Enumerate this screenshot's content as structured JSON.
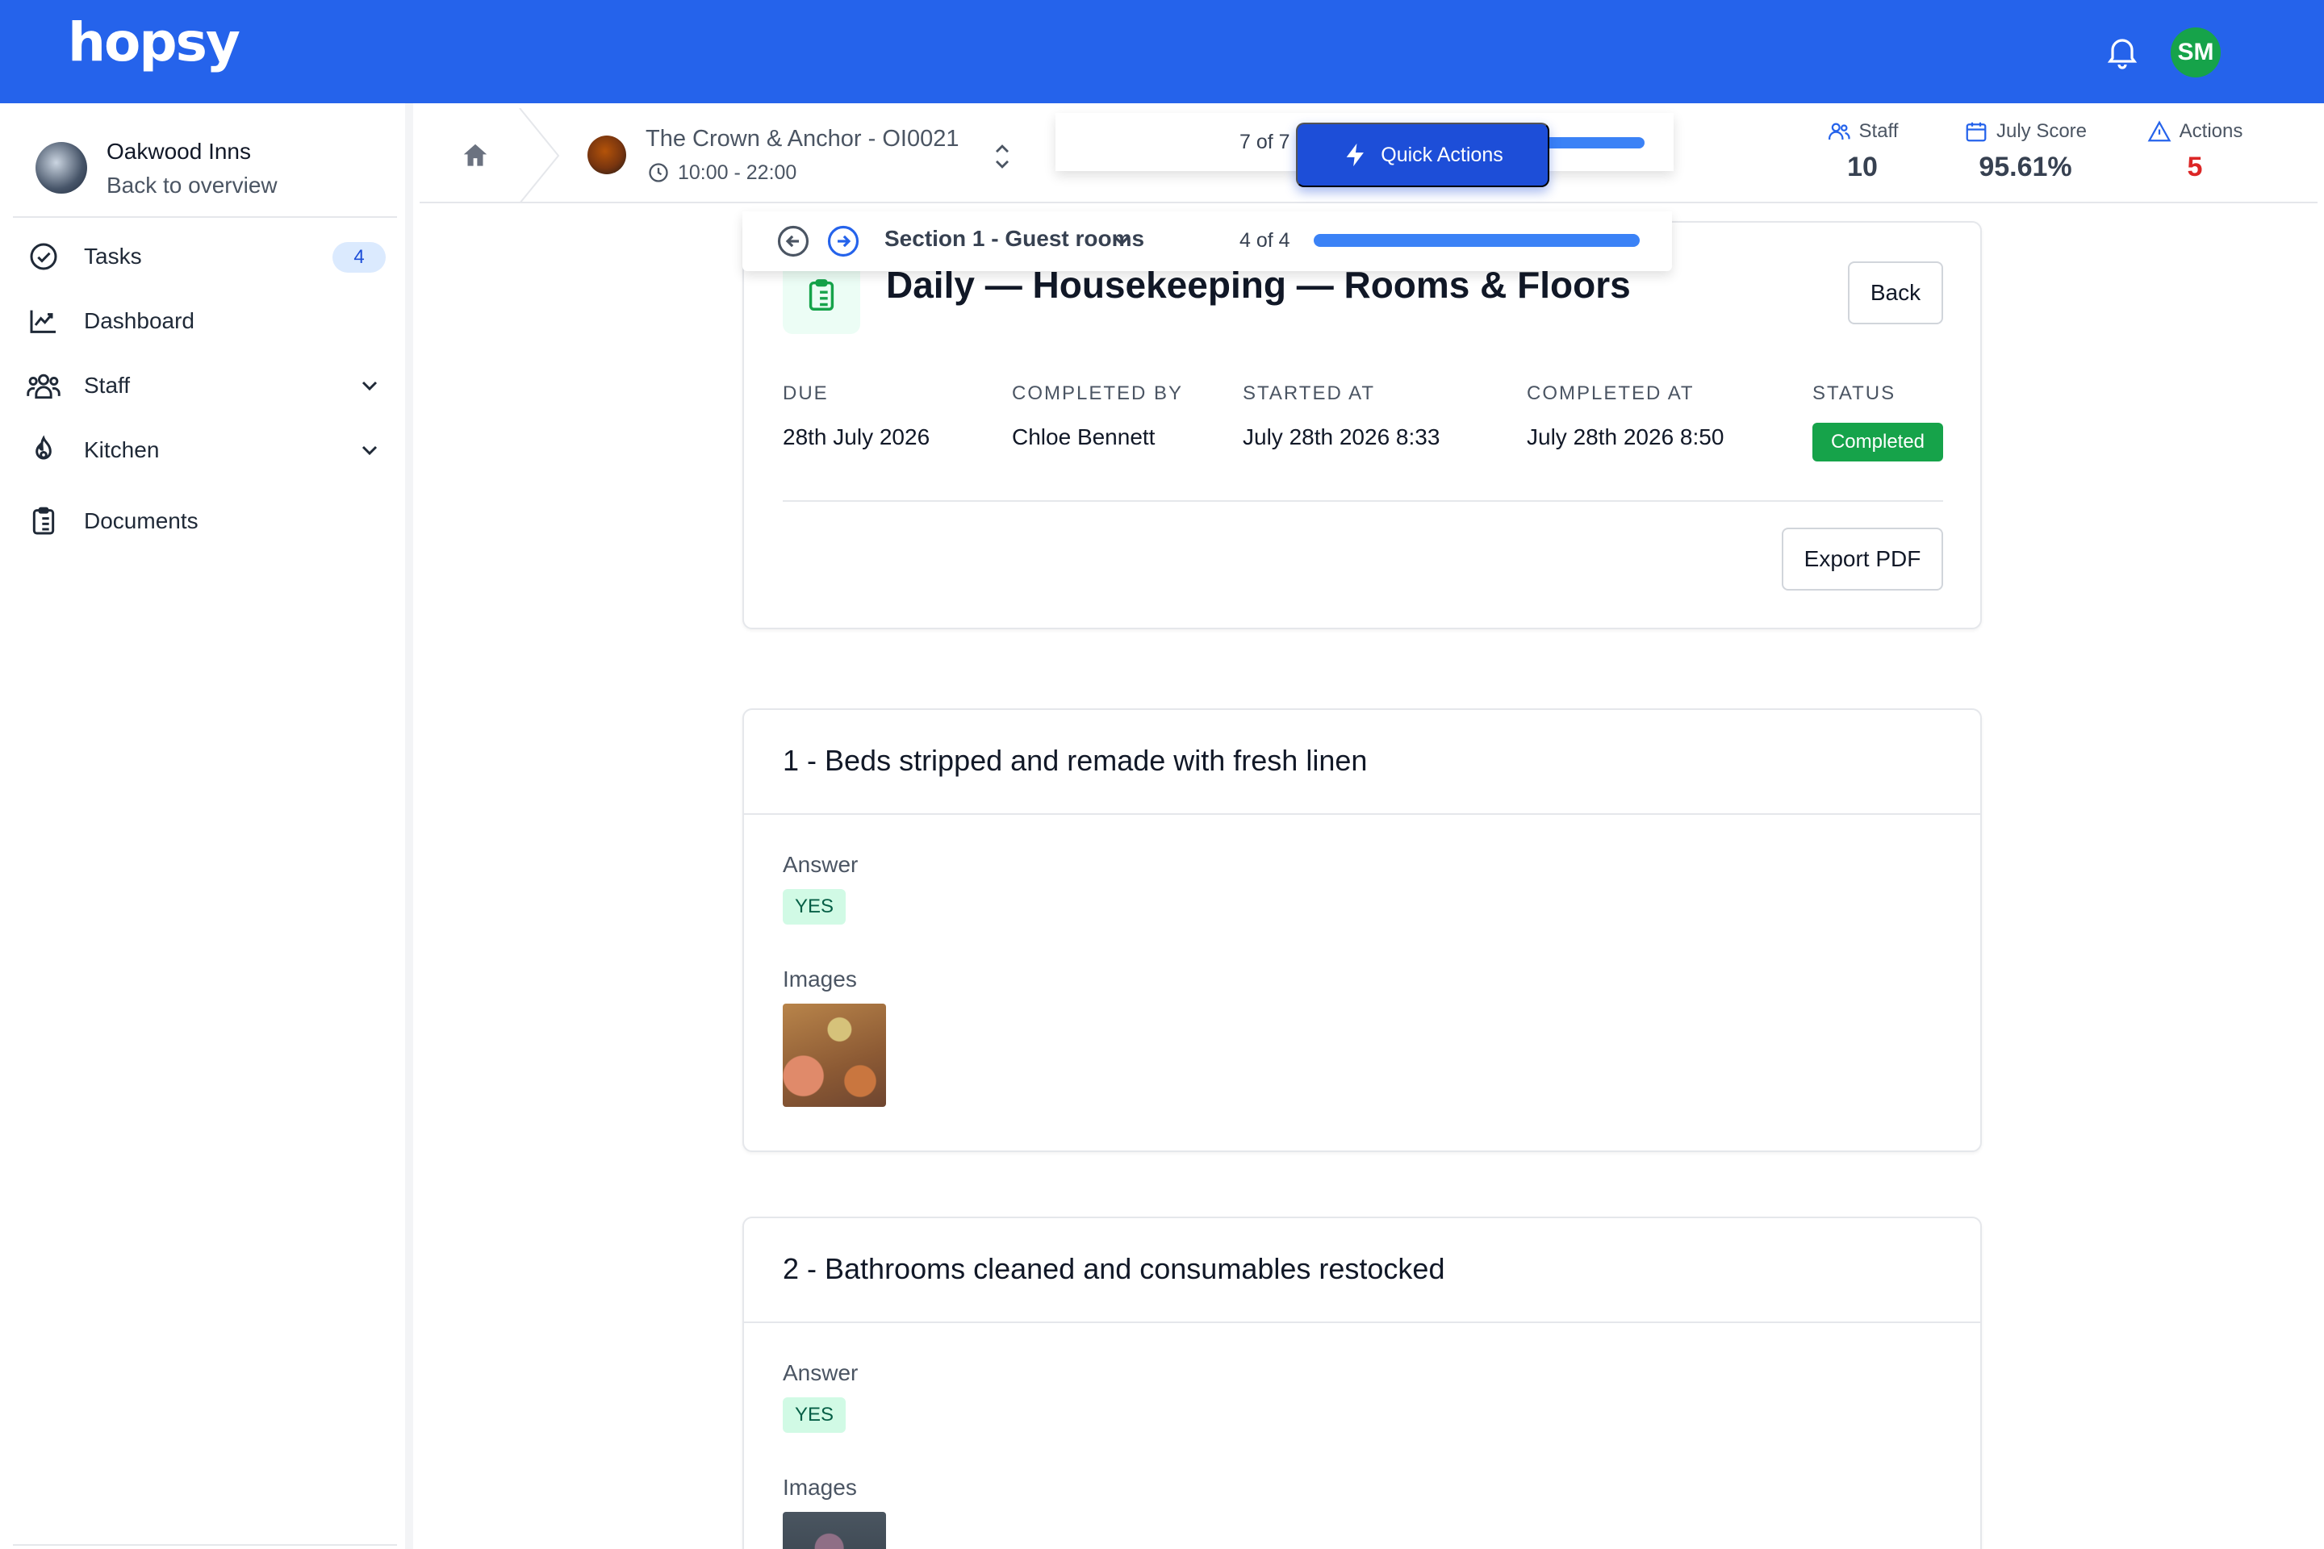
{
  "app": {
    "logo": "hopsy",
    "user_initials": "SM"
  },
  "sidebar": {
    "org_name": "Oakwood Inns",
    "org_back": "Back to overview",
    "items": [
      {
        "label": "Tasks",
        "badge": "4"
      },
      {
        "label": "Dashboard"
      },
      {
        "label": "Staff"
      },
      {
        "label": "Kitchen"
      },
      {
        "label": "Documents"
      }
    ]
  },
  "header": {
    "venue_name": "The Crown & Anchor - OI0021",
    "venue_hours": "10:00 - 22:00",
    "stats": [
      {
        "label": "Staff",
        "value": "10",
        "color": "#374151"
      },
      {
        "label": "July Score",
        "value": "95.61%",
        "color": "#374151"
      },
      {
        "label": "Actions",
        "value": "5",
        "color": "#dc2626"
      }
    ]
  },
  "progress": {
    "label": "7 of 7",
    "fraction": 1.0
  },
  "quick_actions": {
    "label": "Quick Actions"
  },
  "section_nav": {
    "title": "Section 1 - Guest rooms",
    "count": "4 of 4",
    "fraction": 1.0
  },
  "task": {
    "title": "Daily — Housekeeping — Rooms & Floors",
    "back_label": "Back",
    "export_label": "Export PDF",
    "meta": [
      {
        "label": "DUE",
        "value": "28th July 2026"
      },
      {
        "label": "COMPLETED BY",
        "value": "Chloe Bennett"
      },
      {
        "label": "STARTED AT",
        "value": "July 28th 2026 8:33"
      },
      {
        "label": "COMPLETED AT",
        "value": "July 28th 2026 8:50"
      },
      {
        "label": "STATUS",
        "value": "Completed"
      }
    ]
  },
  "questions": [
    {
      "title": "1 - Beds stripped and remade with fresh linen",
      "answer_label": "Answer",
      "answer": "YES",
      "images_label": "Images"
    },
    {
      "title": "2 - Bathrooms cleaned and consumables restocked",
      "answer_label": "Answer",
      "answer": "YES",
      "images_label": "Images"
    }
  ],
  "colors": {
    "brand": "#2563eb",
    "accent": "#1d4ed8",
    "success": "#16a34a",
    "danger": "#dc2626"
  }
}
